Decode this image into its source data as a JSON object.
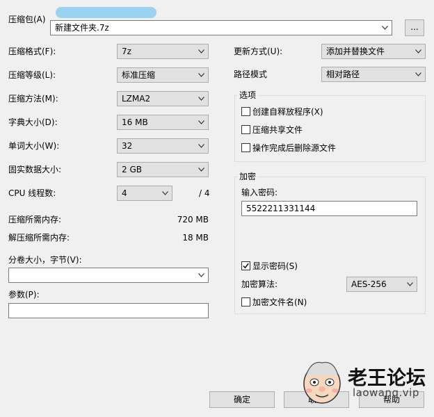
{
  "archive": {
    "label": "压缩包(A)",
    "value": "新建文件夹.7z",
    "browse_label": "..."
  },
  "left": {
    "format": {
      "label": "压缩格式(F):",
      "value": "7z"
    },
    "level": {
      "label": "压缩等级(L):",
      "value": "标准压缩"
    },
    "method": {
      "label": "压缩方法(M):",
      "value": "LZMA2"
    },
    "dict": {
      "label": "字典大小(D):",
      "value": "16 MB"
    },
    "word": {
      "label": "单词大小(W):",
      "value": "32"
    },
    "solid": {
      "label": "固实数据大小:",
      "value": "2 GB"
    },
    "cpu": {
      "label": "CPU 线程数:",
      "value": "4",
      "total": "/ 4"
    },
    "mem_compress": {
      "label": "压缩所需内存:",
      "value": "720 MB"
    },
    "mem_decompress": {
      "label": "解压缩所需内存:",
      "value": "18 MB"
    },
    "split": {
      "label": "分卷大小，字节(V):",
      "value": ""
    },
    "params": {
      "label": "参数(P):",
      "value": ""
    }
  },
  "right": {
    "update": {
      "label": "更新方式(U):",
      "value": "添加并替换文件"
    },
    "path": {
      "label": "路径模式",
      "value": "相对路径"
    },
    "options": {
      "title": "选项",
      "sfx": {
        "label": "创建自释放程序(X)",
        "checked": false
      },
      "shared": {
        "label": "压缩共享文件",
        "checked": false
      },
      "delete": {
        "label": "操作完成后删除源文件",
        "checked": false
      }
    },
    "encryption": {
      "title": "加密",
      "password_label": "输入密码:",
      "password_value": "5522211331144",
      "show_password": {
        "label": "显示密码(S)",
        "checked": true
      },
      "method_label": "加密算法:",
      "method_value": "AES-256",
      "encrypt_names": {
        "label": "加密文件名(N)",
        "checked": false
      }
    }
  },
  "buttons": {
    "ok": "确定",
    "cancel": "取消",
    "help": "帮助"
  },
  "watermark": {
    "title": "老王论坛",
    "url": "laowang.vip"
  }
}
